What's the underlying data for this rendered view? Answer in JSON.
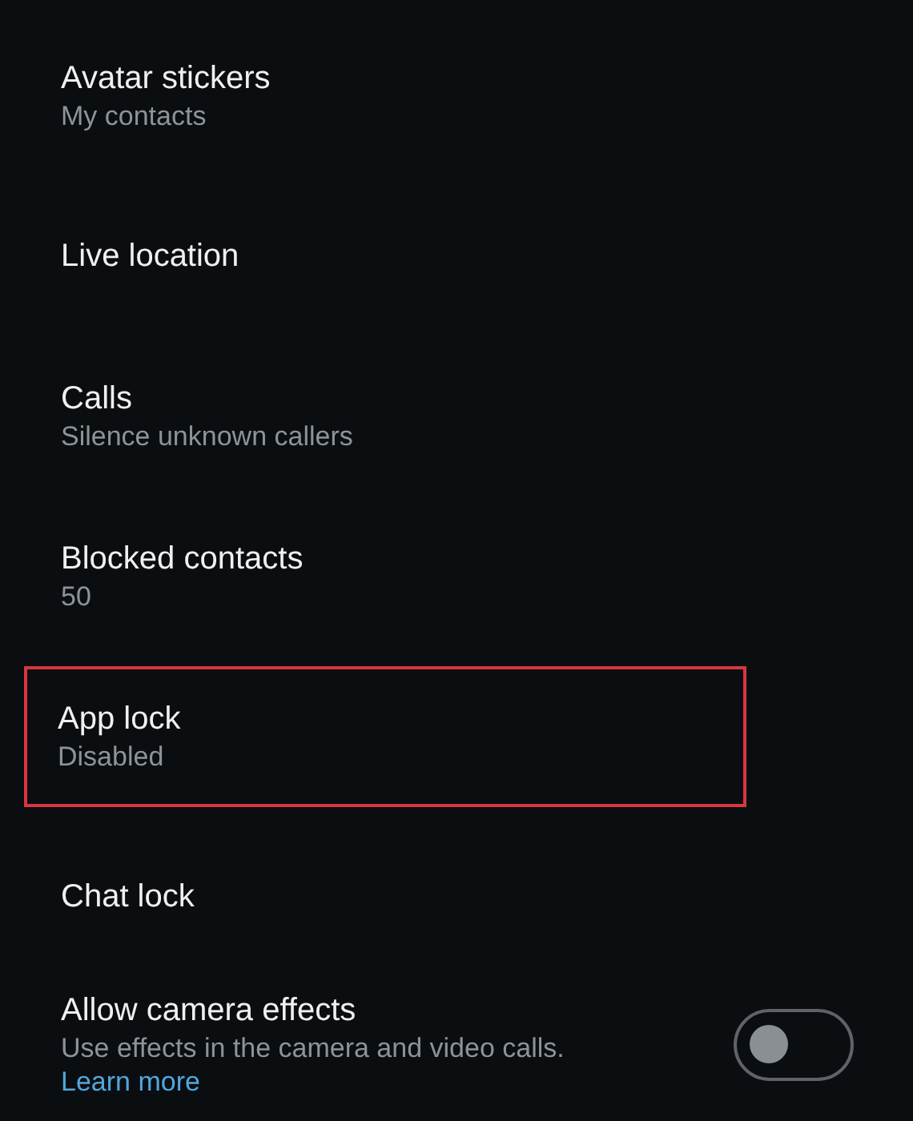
{
  "settings": [
    {
      "kind": "item",
      "title": "Avatar stickers",
      "subtitle": "My contacts",
      "highlighted": false
    },
    {
      "kind": "item",
      "title": "Live location",
      "highlighted": false
    },
    {
      "kind": "item",
      "title": "Calls",
      "subtitle": "Silence unknown callers",
      "highlighted": false
    },
    {
      "kind": "item",
      "title": "Blocked contacts",
      "subtitle": "50",
      "highlighted": false
    },
    {
      "kind": "item",
      "title": "App lock",
      "subtitle": "Disabled",
      "highlighted": true
    },
    {
      "kind": "item",
      "title": "Chat lock",
      "highlighted": false
    },
    {
      "kind": "toggle",
      "title": "Allow camera effects",
      "subtitle": "Use effects in the camera and video calls.",
      "link": "Learn more",
      "on": false,
      "highlighted": false
    }
  ]
}
